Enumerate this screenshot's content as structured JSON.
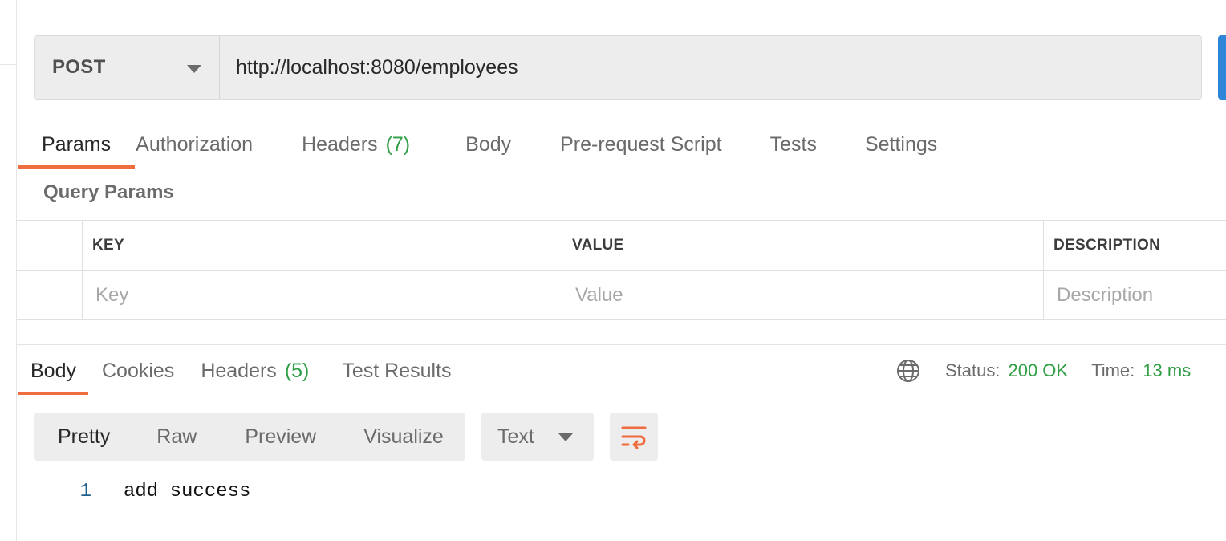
{
  "request": {
    "method": "POST",
    "url": "http://localhost:8080/employees"
  },
  "request_tabs": [
    {
      "label": "Params",
      "count": null,
      "active": true
    },
    {
      "label": "Authorization",
      "count": null,
      "active": false
    },
    {
      "label": "Headers",
      "count": "(7)",
      "active": false
    },
    {
      "label": "Body",
      "count": null,
      "active": false
    },
    {
      "label": "Pre-request Script",
      "count": null,
      "active": false
    },
    {
      "label": "Tests",
      "count": null,
      "active": false
    },
    {
      "label": "Settings",
      "count": null,
      "active": false
    }
  ],
  "query_params": {
    "title": "Query Params",
    "columns": [
      "KEY",
      "VALUE",
      "DESCRIPTION"
    ],
    "placeholders": {
      "key": "Key",
      "value": "Value",
      "description": "Description"
    }
  },
  "response_tabs": [
    {
      "label": "Body",
      "count": null,
      "active": true
    },
    {
      "label": "Cookies",
      "count": null,
      "active": false
    },
    {
      "label": "Headers",
      "count": "(5)",
      "active": false
    },
    {
      "label": "Test Results",
      "count": null,
      "active": false
    }
  ],
  "response_status": {
    "status_label": "Status:",
    "status_value": "200 OK",
    "time_label": "Time:",
    "time_value": "13 ms"
  },
  "response_toolbar": {
    "formats": [
      "Pretty",
      "Raw",
      "Preview",
      "Visualize"
    ],
    "active_format": "Pretty",
    "language": "Text"
  },
  "response_body": [
    {
      "line": "1",
      "text": "add success"
    }
  ],
  "icons": {
    "globe": "globe-icon",
    "wrap": "wrap-lines-icon",
    "method_dropdown": "chevron-down-icon",
    "language_dropdown": "chevron-down-icon"
  },
  "colors": {
    "accent": "#ef6c3e",
    "success": "#2f9e44",
    "send_button": "#2f86d9"
  }
}
